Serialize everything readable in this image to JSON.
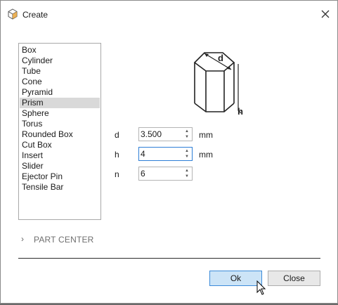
{
  "dialog": {
    "title": "Create"
  },
  "shapes": {
    "items": [
      "Box",
      "Cylinder",
      "Tube",
      "Cone",
      "Pyramid",
      "Prism",
      "Sphere",
      "Torus",
      "Rounded Box",
      "Cut Box",
      "Insert",
      "Slider",
      "Ejector Pin",
      "Tensile Bar"
    ],
    "selected": "Prism"
  },
  "diagram": {
    "label_d": "d",
    "label_h": "h"
  },
  "params": {
    "d": {
      "label": "d",
      "value": "3.500",
      "unit": "mm"
    },
    "h": {
      "label": "h",
      "value": "4",
      "unit": "mm"
    },
    "n": {
      "label": "n",
      "value": "6"
    }
  },
  "part_center": {
    "label": "PART CENTER",
    "expanded": false
  },
  "buttons": {
    "ok": "Ok",
    "close": "Close"
  },
  "colors": {
    "accent": "#3c8bd9",
    "ok_bg": "#cce4f7",
    "selected_row": "#d9d9d9",
    "icon_orange": "#e8a33a"
  }
}
